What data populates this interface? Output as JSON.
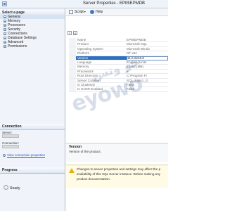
{
  "window": {
    "title": "Server Properties - EPM\\EPMDB"
  },
  "left_pane": {
    "select_page_header": "Select a page",
    "pages": [
      "General",
      "Memory",
      "Processors",
      "Security",
      "Connections",
      "Database Settings",
      "Advanced",
      "Permissions"
    ],
    "connection_header": "Connection",
    "server_label": "Server:",
    "connection_label": "Connection:",
    "view_connection_link": "View connection properties",
    "progress_header": "Progress",
    "progress_status": "Ready"
  },
  "toolbar": {
    "script_label": "Script",
    "help_label": "Help"
  },
  "properties": {
    "rows": [
      {
        "name": "Name",
        "value": "EPM\\EPMDB"
      },
      {
        "name": "Product",
        "value": "Microsoft SQL"
      },
      {
        "name": "Operating System",
        "value": "Microsoft Windo"
      },
      {
        "name": "Platform",
        "value": "NT x64"
      },
      {
        "name": "Version",
        "value": "11.0.2218.0",
        "selected": true
      },
      {
        "name": "Language",
        "value": "English (Unite"
      },
      {
        "name": "Memory",
        "value": "12462 (MB)"
      },
      {
        "name": "Processors",
        "value": "8"
      },
      {
        "name": "Root Directory",
        "value": "C:\\Program Fi"
      },
      {
        "name": "Server Collation",
        "value": "SQL_Latin1_G"
      },
      {
        "name": "Is Clustered",
        "value": "False"
      },
      {
        "name": "Is HADR Enabled",
        "value": "False"
      }
    ]
  },
  "description": {
    "title": "Version",
    "text": "Version of the product."
  },
  "notice": {
    "lines": [
      "Changes to server properties and settings may affect the p",
      "availability of this SQL Server instance. Before making any",
      "product documentation."
    ]
  },
  "watermark": {
    "arabic": "جو وتس",
    "latin": "eyowo"
  }
}
